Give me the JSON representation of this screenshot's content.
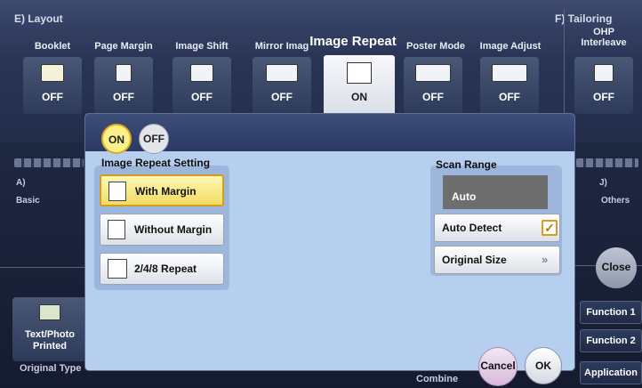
{
  "header": {
    "section_left": "E)  Layout",
    "section_right": "F)  Tailoring",
    "tabs": [
      {
        "label": "Booklet",
        "value": "OFF"
      },
      {
        "label": "Page Margin",
        "value": "OFF"
      },
      {
        "label": "Image Shift",
        "value": "OFF"
      },
      {
        "label": "Mirror Imag",
        "value": "OFF"
      },
      {
        "label": "Image Repeat",
        "value": "ON"
      },
      {
        "label": "Poster Mode",
        "value": "OFF"
      },
      {
        "label": "Image Adjust",
        "value": "OFF"
      },
      {
        "label": "OHP Interleave",
        "value": "OFF"
      }
    ]
  },
  "background": {
    "left_section_a": "A)",
    "left_section_basic": "Basic",
    "right_section_j": "J)",
    "right_section_others": "Others",
    "bottom_left_button_label_1": "Text/Photo",
    "bottom_left_button_label_2": "Printed",
    "bottom_left_caption": "Original Type",
    "bottom_center_caption": "Combine",
    "close_label": "Close",
    "function_buttons": [
      "Function 1",
      "Function 2",
      "Application"
    ]
  },
  "dialog": {
    "toggle_on": "ON",
    "toggle_off": "OFF",
    "image_repeat_setting_title": "Image Repeat Setting",
    "options": [
      {
        "label": "With Margin",
        "selected": true
      },
      {
        "label": "Without Margin",
        "selected": false
      },
      {
        "label": "2/4/8 Repeat",
        "selected": false
      }
    ],
    "scan_range_title": "Scan Range",
    "scan_range_value": "Auto",
    "auto_detect_label": "Auto Detect",
    "auto_detect_checked": true,
    "original_size_label": "Original Size",
    "cancel_label": "Cancel",
    "ok_label": "OK"
  },
  "colors": {
    "dialog_background": "#b7cfee",
    "selected_fill": "#f2dc62",
    "selected_border": "#d89a1f",
    "header_background": "#2a3556"
  }
}
